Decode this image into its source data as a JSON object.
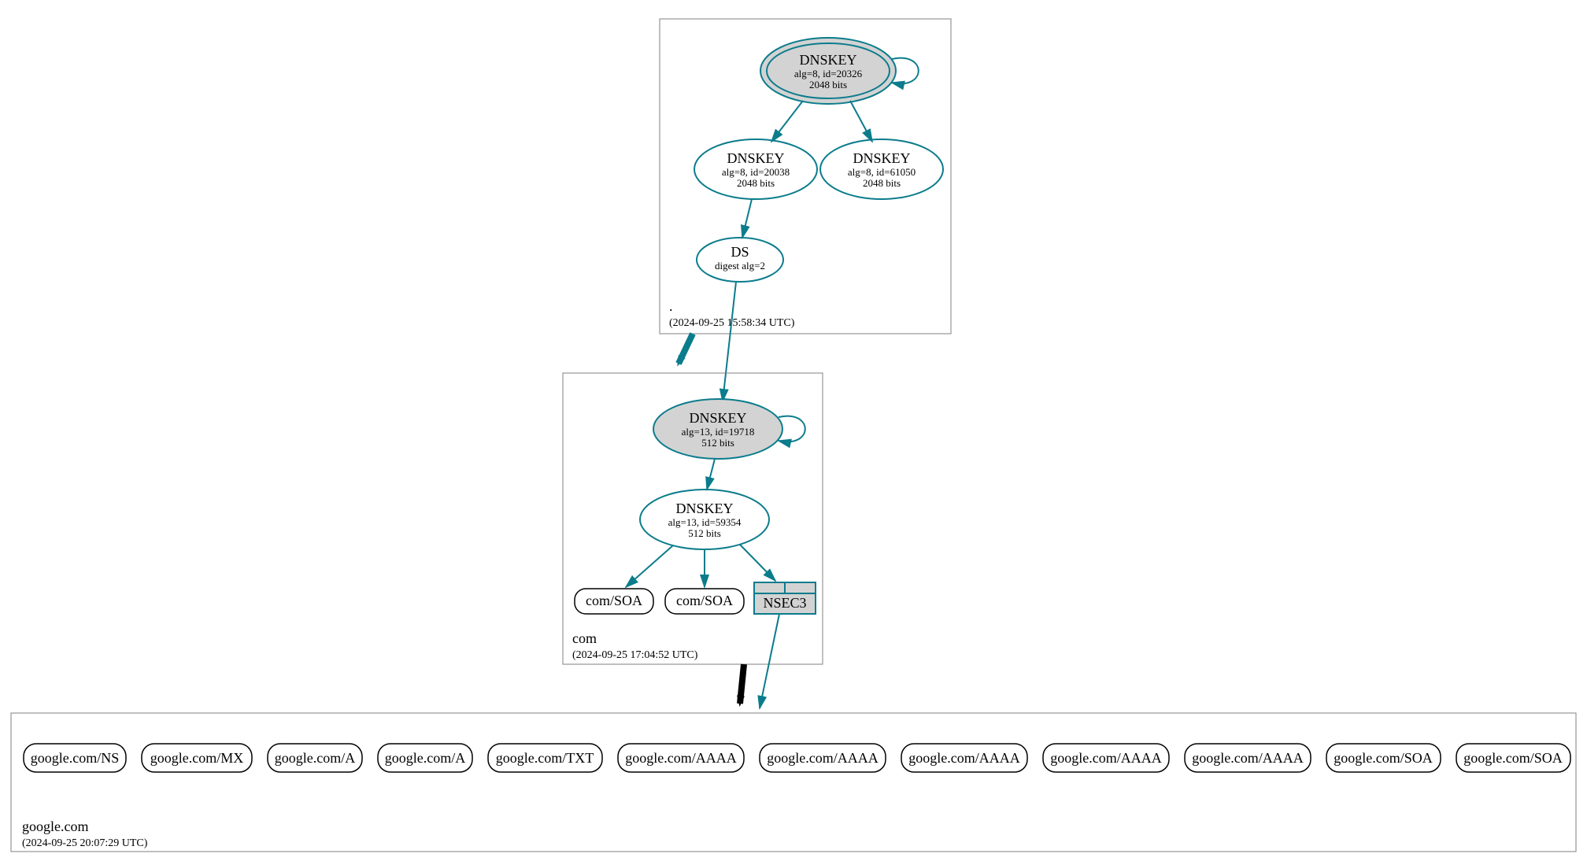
{
  "colors": {
    "teal": "#0b7c8c",
    "gray_fill": "#d3d3d3",
    "box_stroke": "#808080"
  },
  "zones": [
    {
      "id": "root",
      "label": ".",
      "timestamp": "(2024-09-25 15:58:34 UTC)",
      "nodes": [
        {
          "id": "root_ksk",
          "type": "DNSKEY",
          "title": "DNSKEY",
          "line2": "alg=8, id=20326",
          "line3": "2048 bits",
          "filled": true,
          "double": true,
          "selfloop": true
        },
        {
          "id": "root_zsk1",
          "type": "DNSKEY",
          "title": "DNSKEY",
          "line2": "alg=8, id=20038",
          "line3": "2048 bits",
          "filled": false,
          "double": false
        },
        {
          "id": "root_zsk2",
          "type": "DNSKEY",
          "title": "DNSKEY",
          "line2": "alg=8, id=61050",
          "line3": "2048 bits",
          "filled": false,
          "double": false
        },
        {
          "id": "root_ds",
          "type": "DS",
          "title": "DS",
          "line2": "digest alg=2",
          "filled": false,
          "double": false
        }
      ],
      "edges": [
        {
          "from": "root_ksk",
          "to": "root_zsk1"
        },
        {
          "from": "root_ksk",
          "to": "root_zsk2"
        },
        {
          "from": "root_zsk1",
          "to": "root_ds"
        }
      ]
    },
    {
      "id": "com",
      "label": "com",
      "timestamp": "(2024-09-25 17:04:52 UTC)",
      "nodes": [
        {
          "id": "com_ksk",
          "type": "DNSKEY",
          "title": "DNSKEY",
          "line2": "alg=13, id=19718",
          "line3": "512 bits",
          "filled": true,
          "double": false,
          "selfloop": true
        },
        {
          "id": "com_zsk",
          "type": "DNSKEY",
          "title": "DNSKEY",
          "line2": "alg=13, id=59354",
          "line3": "512 bits",
          "filled": false,
          "double": false
        },
        {
          "id": "com_soa1",
          "type": "record",
          "title": "com/SOA"
        },
        {
          "id": "com_soa2",
          "type": "record",
          "title": "com/SOA"
        },
        {
          "id": "com_nsec3",
          "type": "NSEC3",
          "title": "NSEC3"
        }
      ],
      "edges": [
        {
          "from": "com_ksk",
          "to": "com_zsk"
        },
        {
          "from": "com_zsk",
          "to": "com_soa1"
        },
        {
          "from": "com_zsk",
          "to": "com_soa2"
        },
        {
          "from": "com_zsk",
          "to": "com_nsec3"
        }
      ]
    },
    {
      "id": "google",
      "label": "google.com",
      "timestamp": "(2024-09-25 20:07:29 UTC)",
      "records": [
        "google.com/NS",
        "google.com/MX",
        "google.com/A",
        "google.com/A",
        "google.com/TXT",
        "google.com/AAAA",
        "google.com/AAAA",
        "google.com/AAAA",
        "google.com/AAAA",
        "google.com/AAAA",
        "google.com/SOA",
        "google.com/SOA"
      ]
    }
  ],
  "interzone_edges": [
    {
      "from": "root_ds",
      "to": "com_ksk",
      "color": "teal"
    },
    {
      "from_zone": "root",
      "to_zone": "com",
      "color": "teal",
      "big_arrow": true
    },
    {
      "from": "com_nsec3",
      "to_zone": "google",
      "color": "teal"
    },
    {
      "from_zone": "com",
      "to_zone": "google",
      "color": "black",
      "big_arrow": true
    }
  ]
}
